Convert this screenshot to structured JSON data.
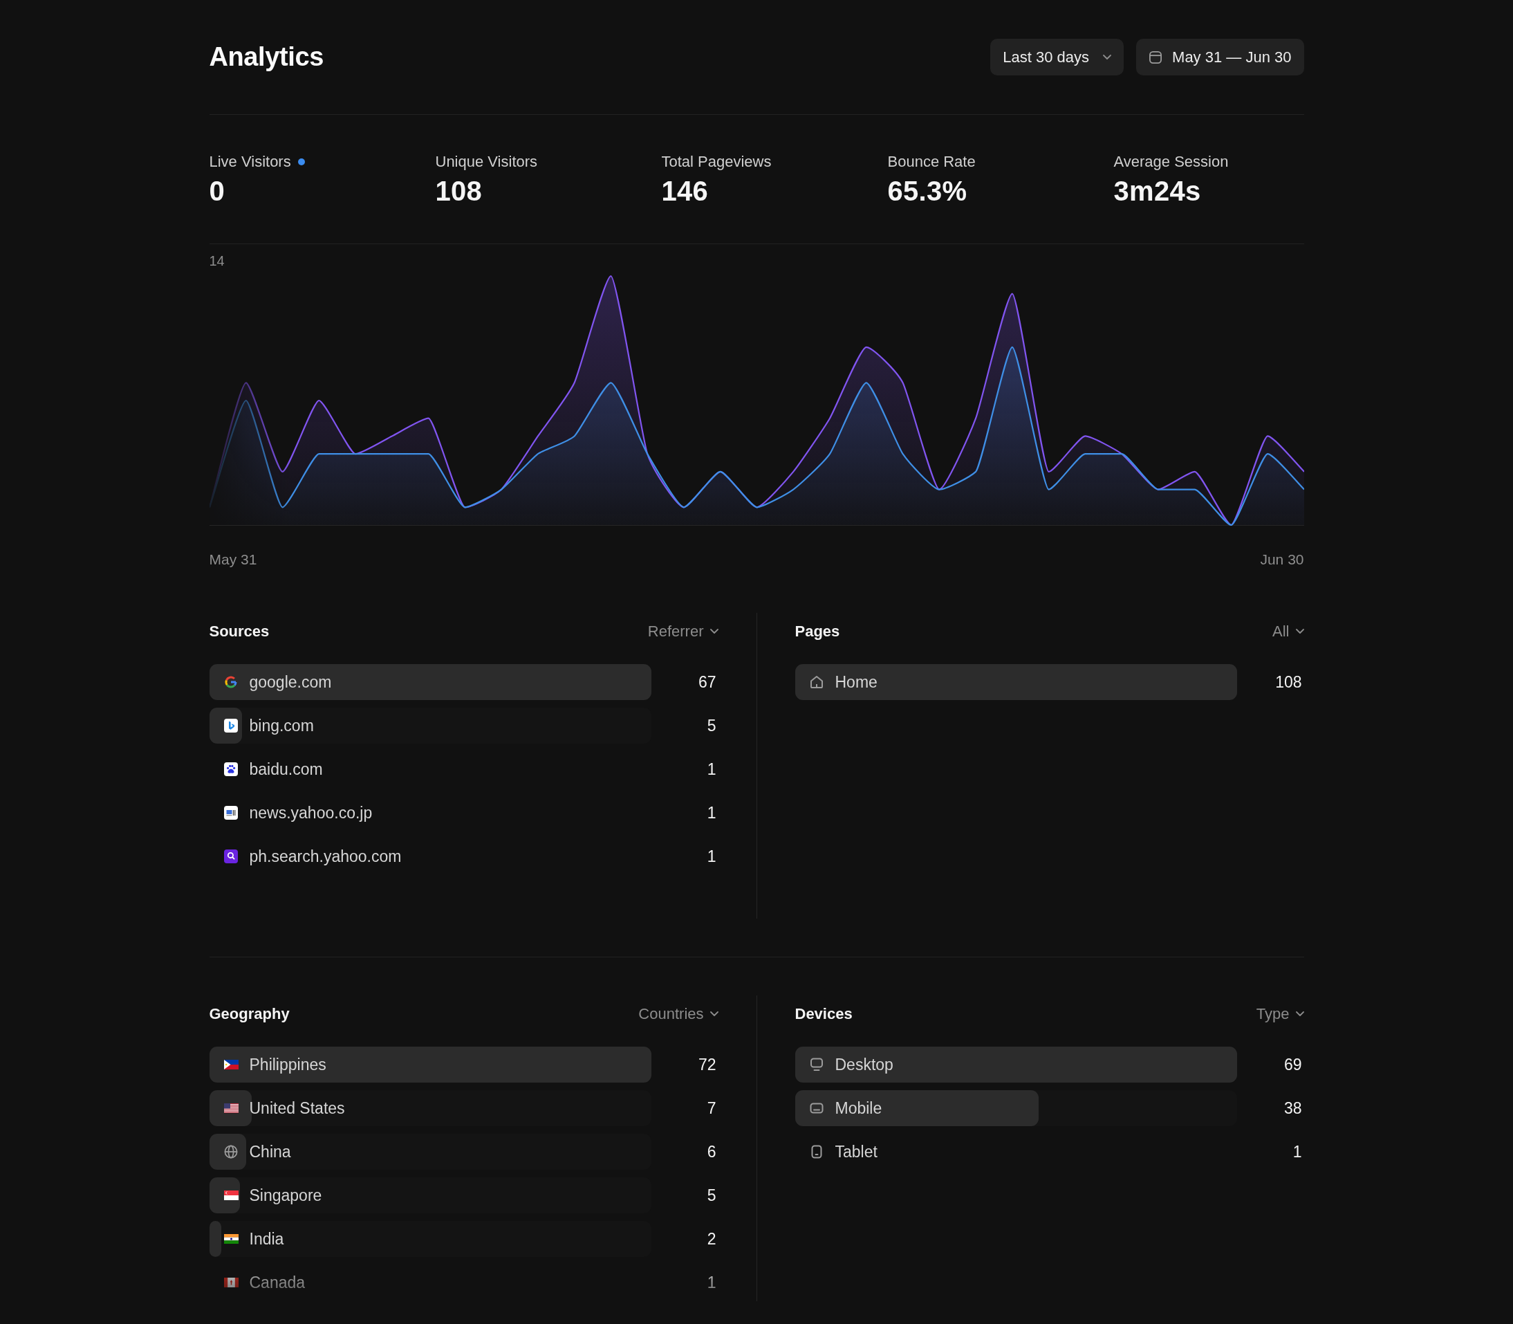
{
  "header": {
    "title": "Analytics",
    "range_dropdown": "Last 30 days",
    "date_range": "May 31 — Jun 30"
  },
  "stats": [
    {
      "label": "Live Visitors",
      "value": "0",
      "live": true
    },
    {
      "label": "Unique Visitors",
      "value": "108",
      "live": false
    },
    {
      "label": "Total Pageviews",
      "value": "146",
      "live": false
    },
    {
      "label": "Bounce Rate",
      "value": "65.3%",
      "live": false
    },
    {
      "label": "Average Session",
      "value": "3m24s",
      "live": false
    }
  ],
  "chart": {
    "y_label": "14",
    "x_start_label": "May 31",
    "x_end_label": "Jun 30"
  },
  "sources": {
    "title": "Sources",
    "filter": "Referrer",
    "items": [
      {
        "name": "google.com",
        "count": "67",
        "level": 1
      },
      {
        "name": "bing.com",
        "count": "5",
        "level": 0.075
      },
      {
        "name": "baidu.com",
        "count": "1"
      },
      {
        "name": "news.yahoo.co.jp",
        "count": "1"
      },
      {
        "name": "ph.search.yahoo.com",
        "count": "1"
      }
    ]
  },
  "pages": {
    "title": "Pages",
    "filter": "All",
    "items": [
      {
        "name": "Home",
        "count": "108",
        "level": 1
      }
    ]
  },
  "geography": {
    "title": "Geography",
    "filter": "Countries",
    "items": [
      {
        "name": "Philippines",
        "count": "72",
        "level": 1
      },
      {
        "name": "United States",
        "count": "7",
        "level": 0.097
      },
      {
        "name": "China",
        "count": "6",
        "level": 0.083
      },
      {
        "name": "Singapore",
        "count": "5",
        "level": 0.069
      },
      {
        "name": "India",
        "count": "2",
        "level": 0.028
      },
      {
        "name": "Canada",
        "count": "1"
      }
    ]
  },
  "devices": {
    "title": "Devices",
    "filter": "Type",
    "items": [
      {
        "name": "Desktop",
        "count": "69",
        "level": 1
      },
      {
        "name": "Mobile",
        "count": "38",
        "level": 0.551
      },
      {
        "name": "Tablet",
        "count": "1"
      }
    ]
  }
}
